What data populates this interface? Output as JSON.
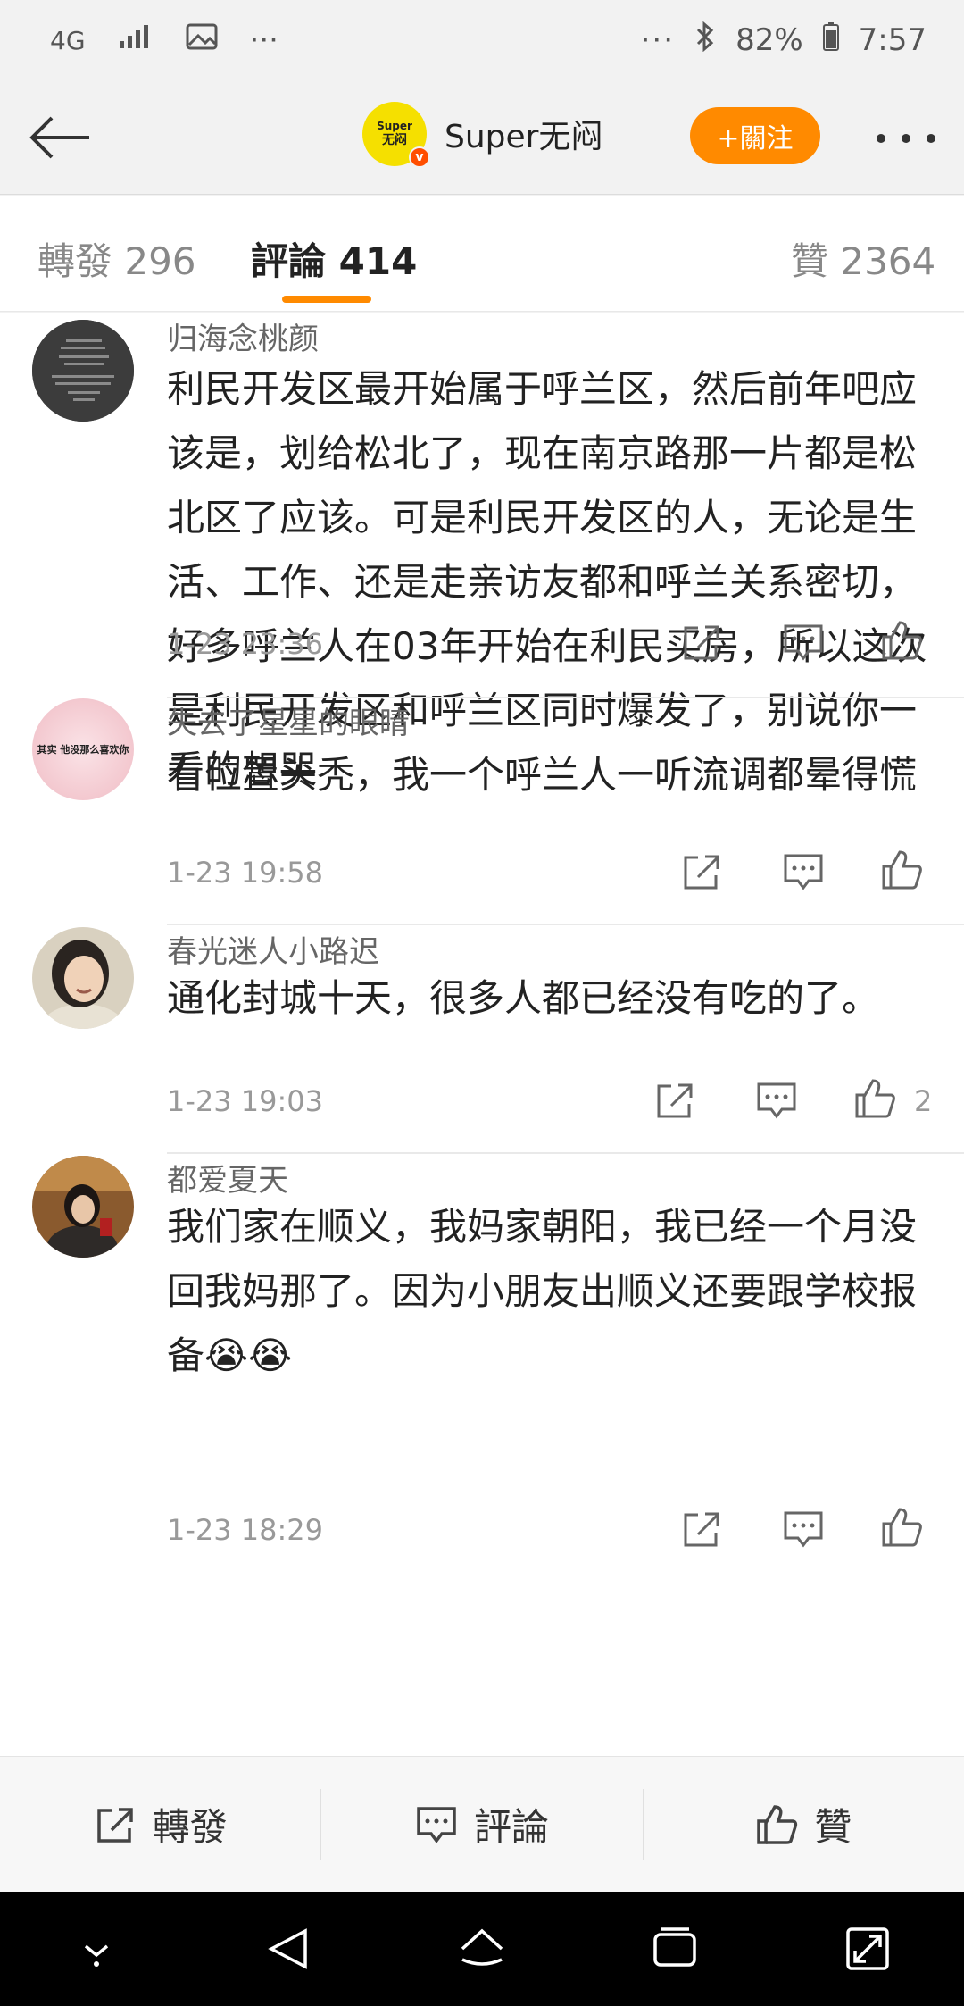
{
  "status_bar": {
    "network": "4G",
    "more": "···",
    "more_right": "···",
    "battery": "82%",
    "time": "7:57"
  },
  "header": {
    "avatar_text_top": "Super",
    "avatar_text_bottom": "无闷",
    "username": "Super无闷",
    "follow_label": "+關注"
  },
  "tabs": [
    {
      "label": "轉發 296"
    },
    {
      "label": "評論 414"
    },
    {
      "label": "贊 2364"
    }
  ],
  "comments": [
    {
      "name": "归海念桃颜",
      "text": "利民开发区最开始属于呼兰区，然后前年吧应该是，划给松北了，现在南京路那一片都是松北区了应该。可是利民开发区的人，无论是生活、工作、还是走亲访友都和呼兰关系密切，好多呼兰人在03年开始在利民买房，所以这次是利民开发区和呼兰区同时爆发了，别说你一看位置头秃，我一个呼兰人一听流调都晕得慌",
      "time": "1-23 23:36",
      "likes": ""
    },
    {
      "name": "失去了星星的眼睛",
      "text": "看的想哭",
      "time": "1-23 19:58",
      "likes": ""
    },
    {
      "name": "春光迷人小路迟",
      "text": "通化封城十天，很多人都已经没有吃的了。",
      "time": "1-23 19:03",
      "likes": "2"
    },
    {
      "name": "都爱夏天",
      "text": "我们家在顺义，我妈家朝阳，我已经一个月没回我妈那了。因为小朋友出顺义还要跟学校报备😭😭",
      "time": "1-23 18:29",
      "likes": ""
    }
  ],
  "avatar2_text": "其实 他没那么喜欢你",
  "bottom_bar": {
    "repost": "轉發",
    "comment": "評論",
    "like": "贊"
  },
  "colors": {
    "accent": "#ff8a00",
    "verified": "#ff4e00"
  }
}
